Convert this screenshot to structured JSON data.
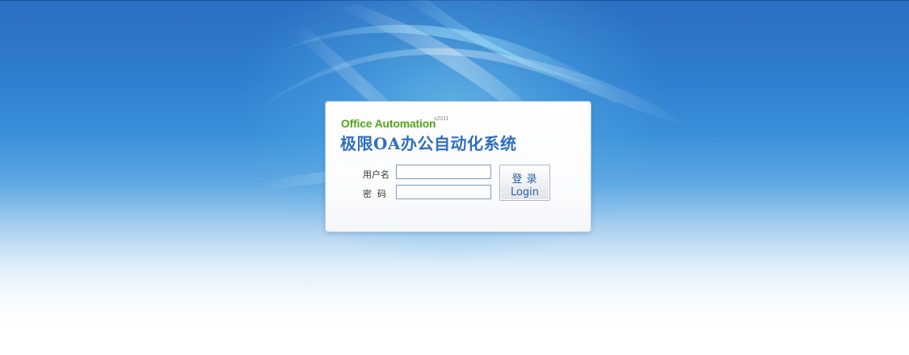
{
  "brand": {
    "english_title": "Office Automation",
    "version": "v2011",
    "chinese_title": "极限OA办公自动化系统"
  },
  "form": {
    "username_label": "用户名",
    "password_label": "密码",
    "username_value": "",
    "password_value": "",
    "login_label_cn": "登录",
    "login_label_en": "Login"
  },
  "colors": {
    "background_top": "#2a6ec2",
    "background_bottom": "#ffffff",
    "brand_green": "#52a51b",
    "brand_blue": "#2f6fbd",
    "button_text": "#2a5f9e"
  }
}
